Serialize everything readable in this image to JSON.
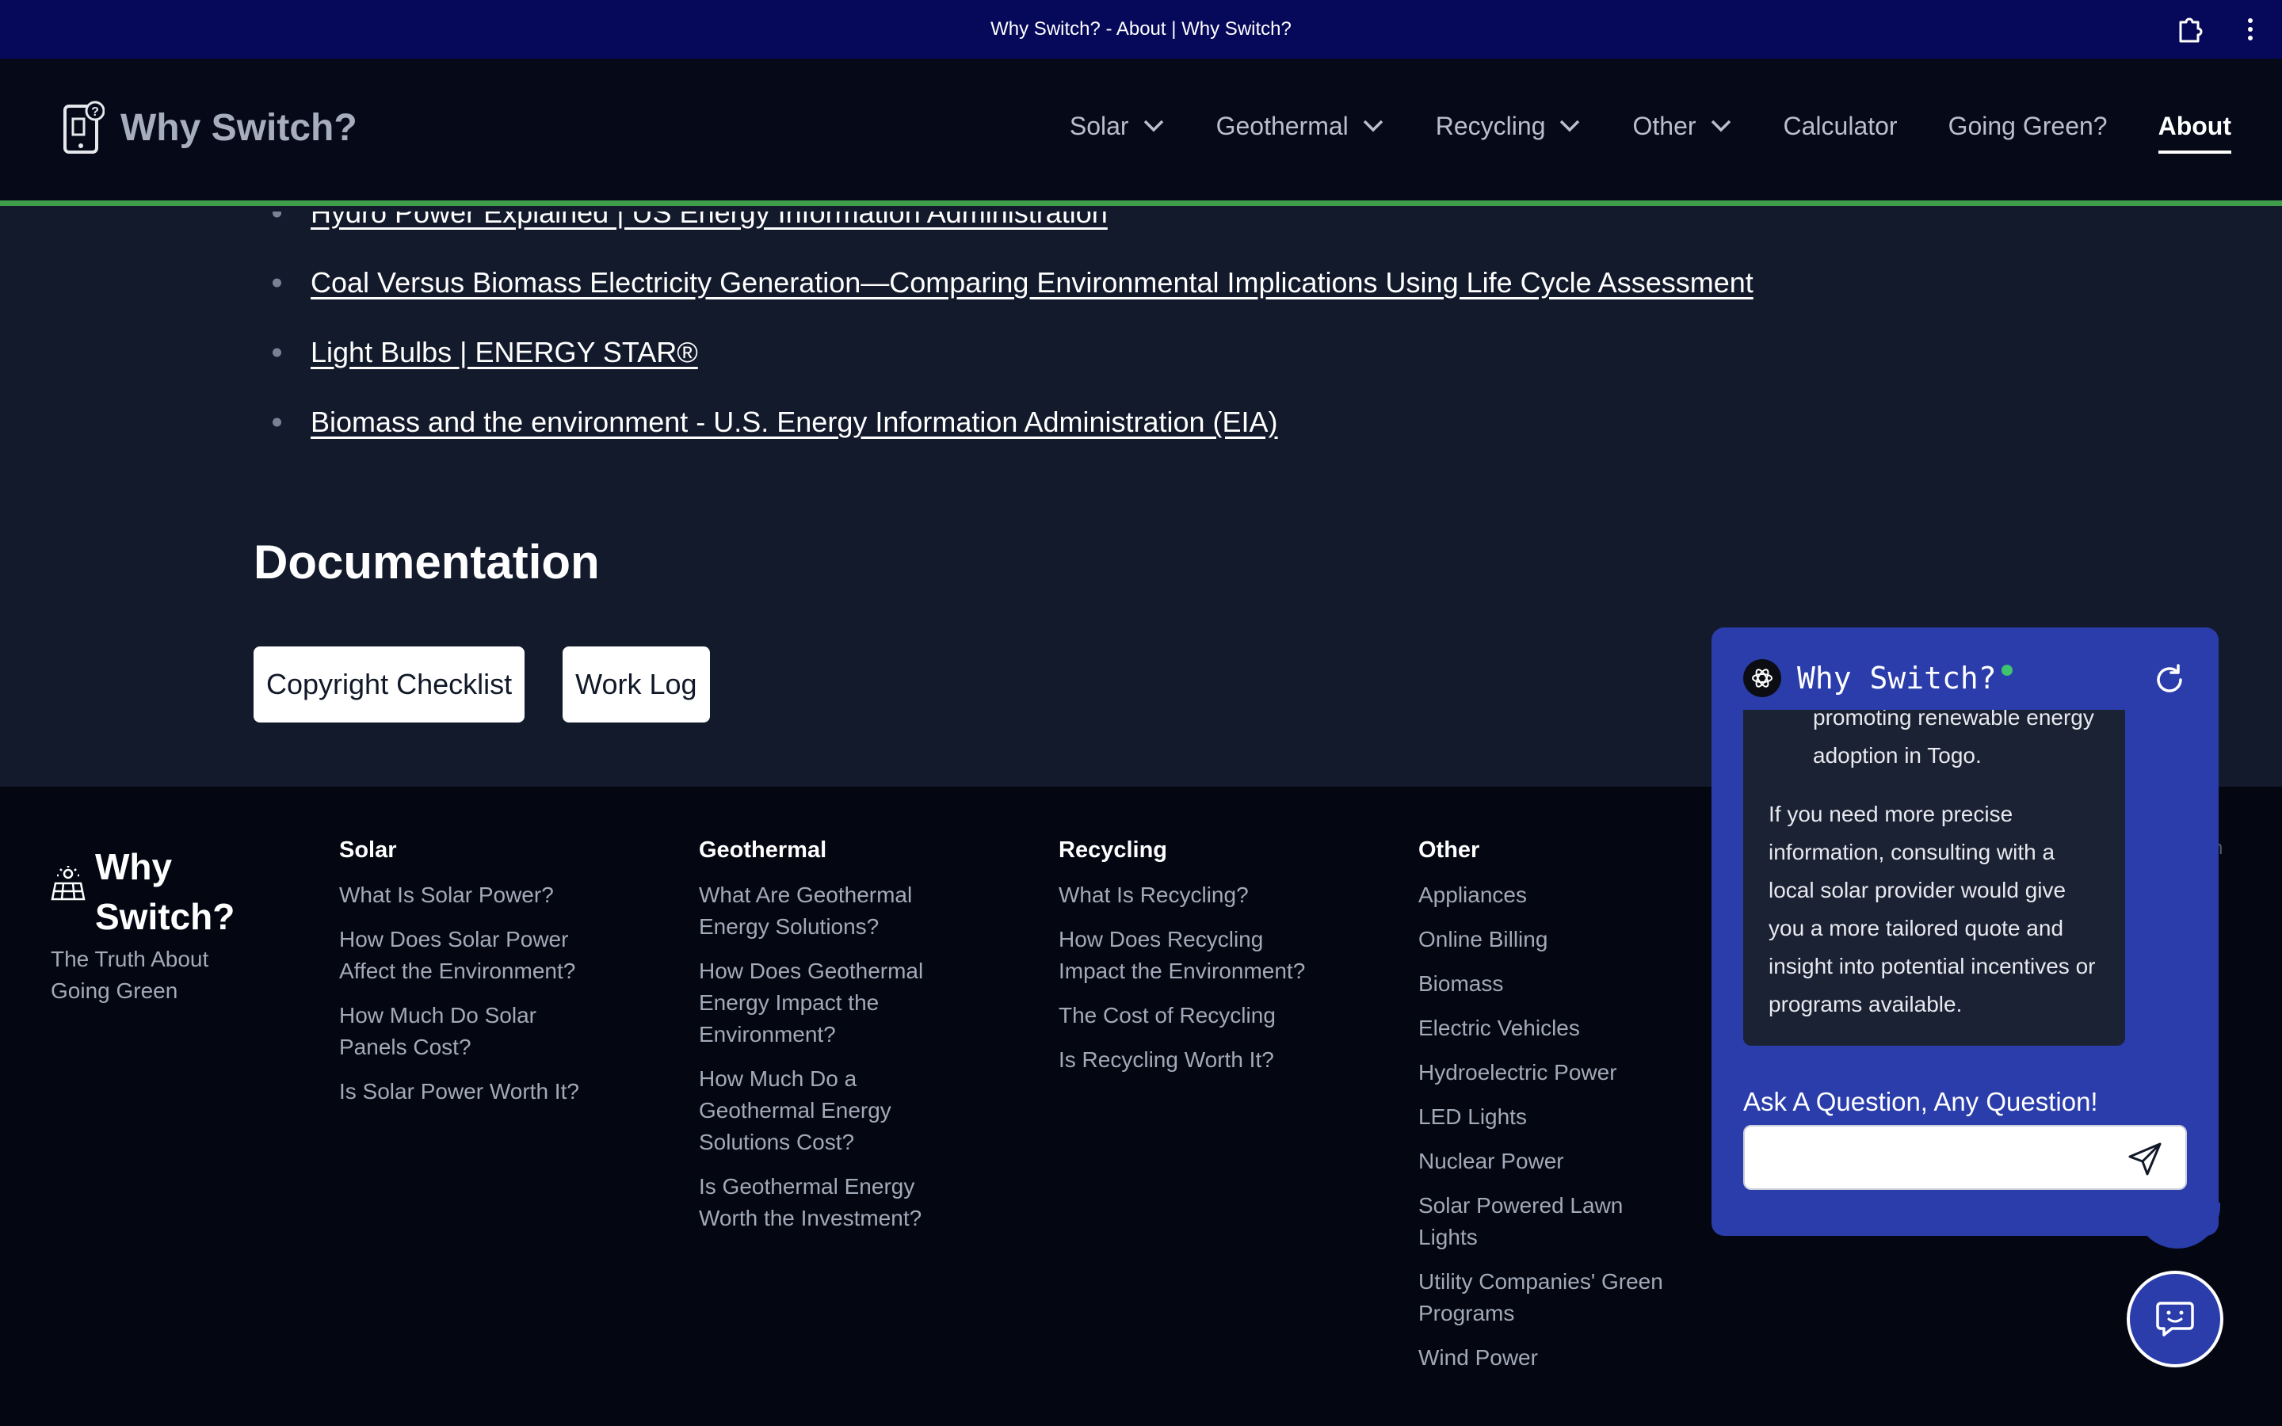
{
  "browser": {
    "tab_title": "Why Switch? - About | Why Switch?"
  },
  "header": {
    "brand_name": "Why Switch?",
    "nav": [
      {
        "label": "Solar",
        "has_dropdown": true
      },
      {
        "label": "Geothermal",
        "has_dropdown": true
      },
      {
        "label": "Recycling",
        "has_dropdown": true
      },
      {
        "label": "Other",
        "has_dropdown": true
      },
      {
        "label": "Calculator",
        "has_dropdown": false
      },
      {
        "label": "Going Green?",
        "has_dropdown": false
      },
      {
        "label": "About",
        "has_dropdown": false,
        "active": true
      }
    ],
    "accent_color": "#3f9d4b"
  },
  "references": [
    "Hydro Power Explained | US Energy Information Administration",
    "Coal Versus Biomass Electricity Generation—Comparing Environmental Implications Using Life Cycle Assessment",
    "Light Bulbs | ENERGY STAR®",
    "Biomass and the environment - U.S. Energy Information Administration (EIA)"
  ],
  "documentation": {
    "heading": "Documentation",
    "buttons": [
      "Copyright Checklist",
      "Work Log"
    ]
  },
  "footer": {
    "brand_name": "Why Switch?",
    "tagline": "The Truth About Going Green",
    "columns": [
      {
        "title": "Solar",
        "links": [
          "What Is Solar Power?",
          "How Does Solar Power Affect the Environment?",
          "How Much Do Solar Panels Cost?",
          "Is Solar Power Worth It?"
        ]
      },
      {
        "title": "Geothermal",
        "links": [
          "What Are Geothermal Energy Solutions?",
          "How Does Geothermal Energy Impact the Environment?",
          "How Much Do a Geothermal Energy Solutions Cost?",
          "Is Geothermal Energy Worth the Investment?"
        ]
      },
      {
        "title": "Recycling",
        "links": [
          "What Is Recycling?",
          "How Does Recycling Impact the Environment?",
          "The Cost of Recycling",
          "Is Recycling Worth It?"
        ]
      },
      {
        "title": "Other",
        "links": [
          "Appliances",
          "Online Billing",
          "Biomass",
          "Electric Vehicles",
          "Hydroelectric Power",
          "LED Lights",
          "Nuclear Power",
          "Solar Powered Lawn Lights",
          "Utility Companies' Green Programs",
          "Wind Power"
        ]
      }
    ],
    "partial_text": "ch"
  },
  "chat": {
    "title": "Why Switch?",
    "status": "online",
    "message_fragment": "promoting renewable energy adoption in Togo.",
    "message_paragraph": "If you need more precise information, consulting with a local solar provider would give you a more tailored quote and insight into potential incentives or programs available.",
    "prompt": "Ask A Question, Any Question!",
    "input_value": "",
    "input_placeholder": "",
    "color": "#2a3dab"
  }
}
